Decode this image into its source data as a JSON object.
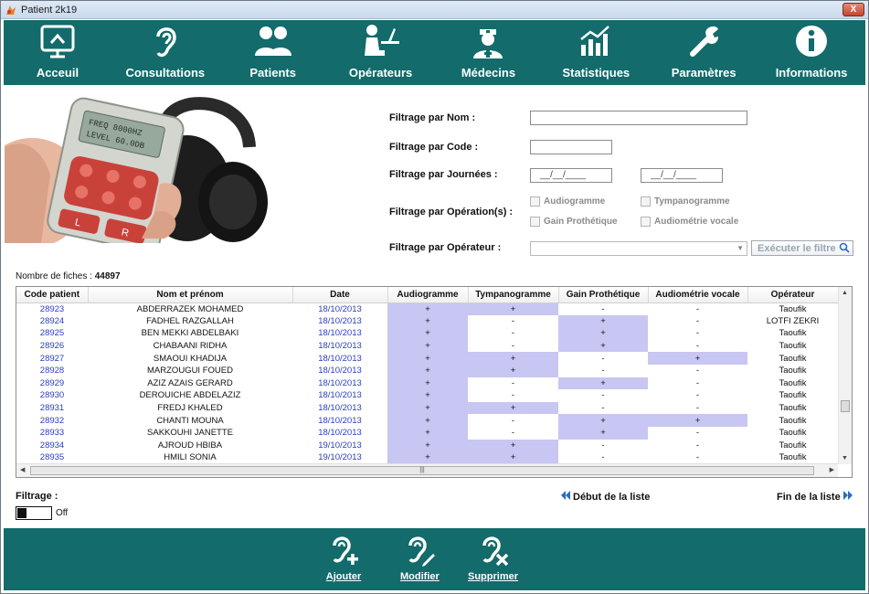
{
  "window": {
    "title": "Patient 2k19",
    "close_label": "X"
  },
  "toolbar": {
    "items": [
      {
        "label": "Acceuil",
        "icon": "home-screen-icon"
      },
      {
        "label": "Consultations",
        "icon": "ear-icon"
      },
      {
        "label": "Patients",
        "icon": "users-icon"
      },
      {
        "label": "Opérateurs",
        "icon": "operator-desk-icon"
      },
      {
        "label": "Médecins",
        "icon": "doctor-icon"
      },
      {
        "label": "Statistiques",
        "icon": "bar-chart-icon"
      },
      {
        "label": "Paramètres",
        "icon": "wrench-icon"
      },
      {
        "label": "Informations",
        "icon": "info-icon"
      }
    ]
  },
  "device": {
    "screen_line1": "FREQ 8000HZ",
    "screen_line2": "LEVEL 60.0DB",
    "left_label": "L",
    "right_label": "R"
  },
  "filters": {
    "nom_label": "Filtrage par Nom :",
    "code_label": "Filtrage par Code :",
    "journees_label": "Filtrage par Journées :",
    "date_placeholder_1": "__/__/____",
    "date_placeholder_2": "__/__/____",
    "operations_label": "Filtrage par Opération(s) :",
    "cb_audiogramme": "Audiogramme",
    "cb_tympanogramme": "Tympanogramme",
    "cb_gain": "Gain Prothétique",
    "cb_audiometrie": "Audiométrie vocale",
    "operateur_label": "Filtrage par Opérateur :",
    "execute_label": "Exécuter le filtre"
  },
  "records": {
    "label": "Nombre de fiches :",
    "count": "44897"
  },
  "table": {
    "columns": [
      "Code patient",
      "Nom et prénom",
      "Date",
      "Audiogramme",
      "Tympanogramme",
      "Gain Prothétique",
      "Audiométrie vocale",
      "Opérateur"
    ],
    "rows": [
      [
        "28923",
        "ABDERRAZEK MOHAMED",
        "18/10/2013",
        "+",
        "+",
        "-",
        "-",
        "Taoufik"
      ],
      [
        "28924",
        "FADHEL RAZGALLAH",
        "18/10/2013",
        "+",
        "-",
        "+",
        "-",
        "LOTFI ZEKRI"
      ],
      [
        "28925",
        "BEN MEKKI ABDELBAKI",
        "18/10/2013",
        "+",
        "-",
        "+",
        "-",
        "Taoufik"
      ],
      [
        "28926",
        "CHABAANI RIDHA",
        "18/10/2013",
        "+",
        "-",
        "+",
        "-",
        "Taoufik"
      ],
      [
        "28927",
        "SMAOUI KHADIJA",
        "18/10/2013",
        "+",
        "+",
        "-",
        "+",
        "Taoufik"
      ],
      [
        "28928",
        "MARZOUGUI FOUED",
        "18/10/2013",
        "+",
        "+",
        "-",
        "-",
        "Taoufik"
      ],
      [
        "28929",
        "AZIZ AZAIS GERARD",
        "18/10/2013",
        "+",
        "-",
        "+",
        "-",
        "Taoufik"
      ],
      [
        "28930",
        "DEROUICHE ABDELAZIZ",
        "18/10/2013",
        "+",
        "-",
        "-",
        "-",
        "Taoufik"
      ],
      [
        "28931",
        "FREDJ KHALED",
        "18/10/2013",
        "+",
        "+",
        "-",
        "-",
        "Taoufik"
      ],
      [
        "28932",
        "CHANTI MOUNA",
        "18/10/2013",
        "+",
        "-",
        "+",
        "+",
        "Taoufik"
      ],
      [
        "28933",
        "SAKKOUHI JANETTE",
        "18/10/2013",
        "+",
        "-",
        "+",
        "-",
        "Taoufik"
      ],
      [
        "28934",
        "AJROUD HBIBA",
        "19/10/2013",
        "+",
        "+",
        "-",
        "-",
        "Taoufik"
      ],
      [
        "28935",
        "HMILI SONIA",
        "19/10/2013",
        "+",
        "+",
        "-",
        "-",
        "Taoufik"
      ]
    ]
  },
  "filtrage": {
    "label": "Filtrage :",
    "state": "Off"
  },
  "nav": {
    "start_label": "Début de la liste",
    "end_label": "Fin de la liste"
  },
  "footer": {
    "add_label": "Ajouter",
    "edit_label": "Modifier",
    "delete_label": "Supprimer"
  },
  "colors": {
    "toolbar_bg": "#136b6b",
    "highlight": "#c8c6f2",
    "code_blue": "#2a3fbf",
    "nav_arrow": "#2b6cc4"
  }
}
